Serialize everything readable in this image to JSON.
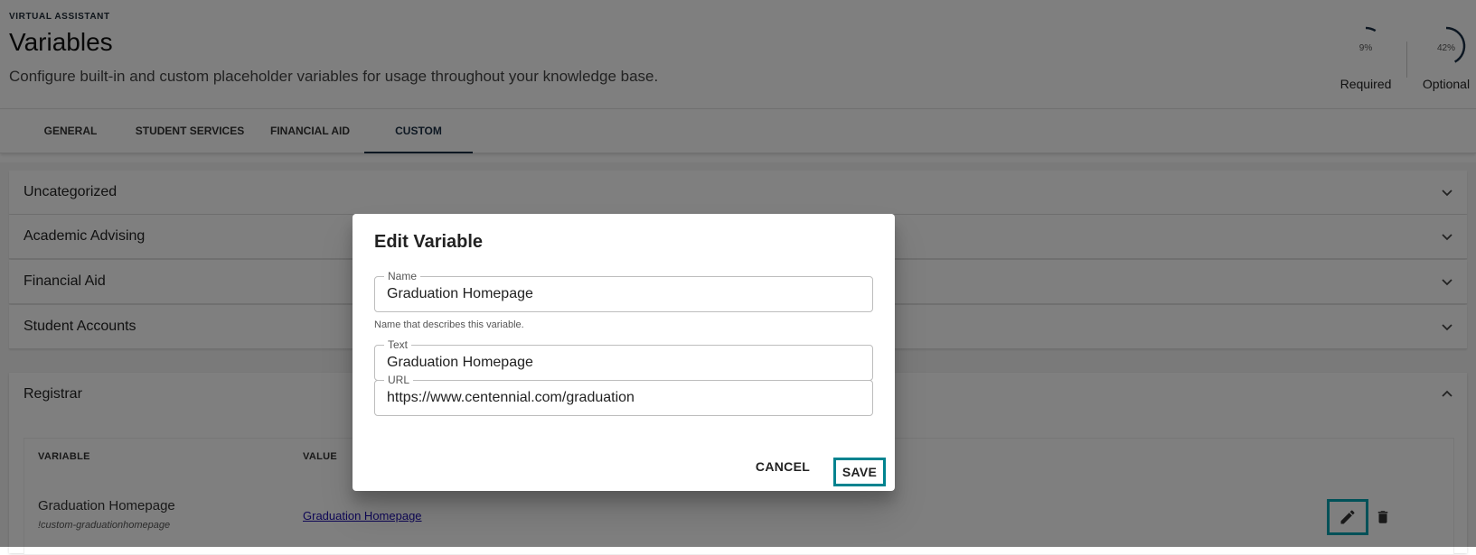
{
  "header": {
    "eyebrow": "VIRTUAL ASSISTANT",
    "title": "Variables",
    "subtitle": "Configure built-in and custom placeholder variables for usage throughout your knowledge base."
  },
  "progress": {
    "required": {
      "percent_label": "9%",
      "label": "Required",
      "value": 0.09
    },
    "optional": {
      "percent_label": "42%",
      "label": "Optional",
      "value": 0.42
    }
  },
  "tabs": [
    {
      "label": "GENERAL",
      "active": false
    },
    {
      "label": "STUDENT SERVICES",
      "active": false
    },
    {
      "label": "FINANCIAL AID",
      "active": false
    },
    {
      "label": "CUSTOM",
      "active": true
    }
  ],
  "sections": [
    {
      "label": "Uncategorized"
    },
    {
      "label": "Academic Advising"
    },
    {
      "label": "Financial Aid"
    },
    {
      "label": "Student Accounts"
    }
  ],
  "registrar": {
    "label": "Registrar",
    "columns": {
      "variable": "VARIABLE",
      "value": "VALUE"
    },
    "row": {
      "name": "Graduation Homepage",
      "key": "!custom-graduationhomepage",
      "value_link": "Graduation Homepage"
    }
  },
  "dialog": {
    "title": "Edit Variable",
    "name_label": "Name",
    "name_value": "Graduation Homepage",
    "name_helper": "Name that describes this variable.",
    "text_label": "Text",
    "text_value": "Graduation Homepage",
    "url_label": "URL",
    "url_value": "https://www.centennial.com/graduation",
    "cancel_label": "CANCEL",
    "save_label": "SAVE"
  },
  "colors": {
    "highlight": "#00a3b1",
    "tab_active": "#1a2e44",
    "link": "#1a0dab"
  }
}
